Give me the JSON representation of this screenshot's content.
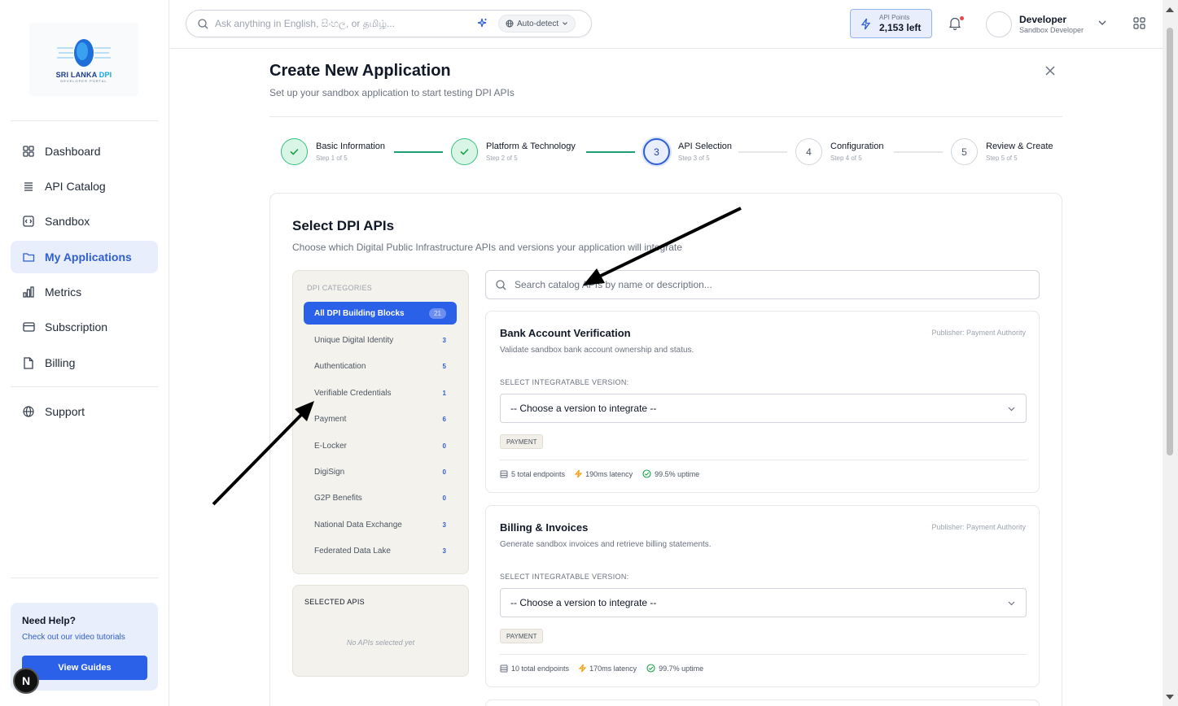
{
  "logo": {
    "name_main": "SRI LANKA ",
    "name_accent": "DPI",
    "tagline": "DEVELOPER PORTAL"
  },
  "sidebar": {
    "items": [
      {
        "label": "Dashboard",
        "icon": "grid-icon"
      },
      {
        "label": "API Catalog",
        "icon": "layers-icon"
      },
      {
        "label": "Sandbox",
        "icon": "code-box-icon"
      },
      {
        "label": "My Applications",
        "icon": "folder-icon",
        "active": true
      },
      {
        "label": "Metrics",
        "icon": "bar-chart-icon"
      },
      {
        "label": "Subscription",
        "icon": "credit-card-icon"
      },
      {
        "label": "Billing",
        "icon": "document-icon"
      },
      {
        "label": "Support",
        "icon": "globe-icon"
      }
    ],
    "help": {
      "title": "Need Help?",
      "subtitle": "Check out our video tutorials",
      "button": "View Guides"
    },
    "badge": "N"
  },
  "header": {
    "search_placeholder": "Ask anything in English, සිංහල, or தமிழ்...",
    "language": "Auto-detect",
    "points_label": "API Points",
    "points_value": "2,153 left",
    "user_name": "Developer",
    "user_role": "Sandbox Developer"
  },
  "main": {
    "title": "Create New Application",
    "subtitle": "Set up your sandbox application to start testing DPI APIs",
    "steps": [
      {
        "name": "Basic Information",
        "sub": "Step 1 of 5",
        "num": "1",
        "state": "done"
      },
      {
        "name": "Platform & Technology",
        "sub": "Step 2 of 5",
        "num": "2",
        "state": "done"
      },
      {
        "name": "API Selection",
        "sub": "Step 3 of 5",
        "num": "3",
        "state": "current"
      },
      {
        "name": "Configuration",
        "sub": "Step 4 of 5",
        "num": "4",
        "state": "todo"
      },
      {
        "name": "Review & Create",
        "sub": "Step 5 of 5",
        "num": "5",
        "state": "todo"
      }
    ],
    "section_title": "Select DPI APIs",
    "section_subtitle": "Choose which Digital Public Infrastructure APIs and versions your application will integrate",
    "categories_heading": "DPI CATEGORIES",
    "categories": [
      {
        "label": "All DPI Building Blocks",
        "count": "21",
        "active": true
      },
      {
        "label": "Unique Digital Identity",
        "count": "3"
      },
      {
        "label": "Authentication",
        "count": "5"
      },
      {
        "label": "Verifiable Credentials",
        "count": "1"
      },
      {
        "label": "Payment",
        "count": "6"
      },
      {
        "label": "E-Locker",
        "count": "0"
      },
      {
        "label": "DigiSign",
        "count": "0"
      },
      {
        "label": "G2P Benefits",
        "count": "0"
      },
      {
        "label": "National Data Exchange",
        "count": "3"
      },
      {
        "label": "Federated Data Lake",
        "count": "3"
      }
    ],
    "selected_heading": "SELECTED APIS",
    "selected_empty": "No APIs selected yet",
    "api_search_placeholder": "Search catalog APIs by name or description...",
    "apis": [
      {
        "title": "Bank Account Verification",
        "publisher": "Publisher: Payment Authority",
        "description": "Validate sandbox bank account ownership and status.",
        "version_label": "SELECT INTEGRATABLE VERSION:",
        "version_value": "-- Choose a version to integrate --",
        "tag": "PAYMENT",
        "endpoints": "5 total endpoints",
        "latency": "190ms latency",
        "uptime": "99.5% uptime"
      },
      {
        "title": "Billing & Invoices",
        "publisher": "Publisher: Payment Authority",
        "description": "Generate sandbox invoices and retrieve billing statements.",
        "version_label": "SELECT INTEGRATABLE VERSION:",
        "version_value": "-- Choose a version to integrate --",
        "tag": "PAYMENT",
        "endpoints": "10 total endpoints",
        "latency": "170ms latency",
        "uptime": "99.7% uptime"
      }
    ]
  },
  "colors": {
    "primary": "#2b60e8",
    "active_bg": "#e8eefb",
    "success": "#34c27c",
    "category_bg": "#f4f2ec"
  }
}
